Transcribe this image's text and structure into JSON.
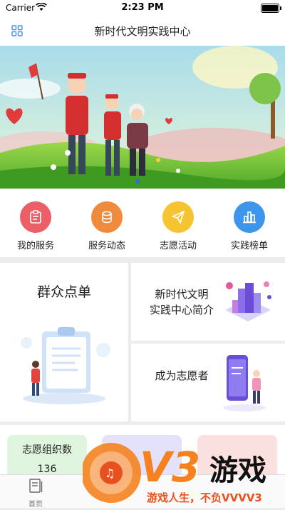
{
  "status_bar": {
    "carrier": "Carrier",
    "time": "2:23 PM"
  },
  "header": {
    "title": "新时代文明实践中心"
  },
  "services": [
    {
      "label": "我的服务",
      "icon": "clipboard-icon",
      "color": "#ec5f67"
    },
    {
      "label": "服务动态",
      "icon": "coins-icon",
      "color": "#f08a3c"
    },
    {
      "label": "志愿活动",
      "icon": "paper-plane-icon",
      "color": "#f6c431"
    },
    {
      "label": "实践榜单",
      "icon": "bar-chart-icon",
      "color": "#3d96ec"
    }
  ],
  "cards": {
    "order": {
      "title": "群众点单"
    },
    "intro": {
      "line1": "新时代文明",
      "line2": "实践中心简介"
    },
    "volunteer": {
      "title": "成为志愿者"
    }
  },
  "stats": [
    {
      "label": "志愿组织数",
      "value": "136",
      "color": "#dff5dd"
    },
    {
      "label": "",
      "value": "",
      "color": "#e4e2fb"
    },
    {
      "label": "",
      "value": "",
      "color": "#fbe0e0"
    }
  ],
  "tab_bar": {
    "home_label": "首页"
  },
  "watermark": {
    "logo": "V3",
    "brand": "游戏",
    "slogan": "游戏人生，不负VVVV3"
  },
  "colors": {
    "accent": "#3d96ec",
    "banner_sky": "#b8e4f0",
    "watermark_orange": "#f5821f"
  }
}
